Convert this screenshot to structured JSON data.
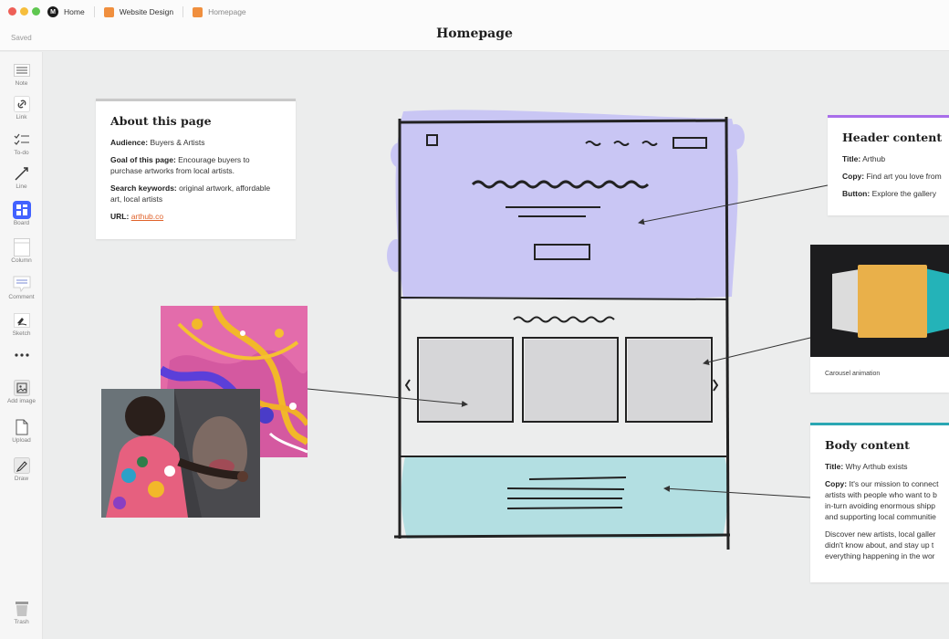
{
  "window": {
    "breadcrumbs": [
      {
        "label": "Home",
        "icon": "miro-logo-icon"
      },
      {
        "label": "Website Design",
        "icon": "board-icon"
      },
      {
        "label": "Homepage",
        "icon": "board-icon"
      }
    ],
    "saved_status": "Saved",
    "title": "Homepage"
  },
  "toolbar": {
    "items": [
      {
        "label": "Note",
        "icon": "note-icon"
      },
      {
        "label": "Link",
        "icon": "link-icon"
      },
      {
        "label": "To-do",
        "icon": "todo-icon"
      },
      {
        "label": "Line",
        "icon": "line-icon"
      },
      {
        "label": "Board",
        "icon": "board-icon"
      },
      {
        "label": "Column",
        "icon": "column-icon"
      },
      {
        "label": "Comment",
        "icon": "comment-icon"
      },
      {
        "label": "Sketch",
        "icon": "sketch-icon"
      },
      {
        "label": "",
        "icon": "more-icon"
      },
      {
        "label": "Add image",
        "icon": "add-image-icon"
      },
      {
        "label": "Upload",
        "icon": "upload-icon"
      },
      {
        "label": "Draw",
        "icon": "draw-icon"
      },
      {
        "label": "Trash",
        "icon": "trash-icon"
      }
    ]
  },
  "about": {
    "title": "About this page",
    "audience_label": "Audience:",
    "audience_value": "Buyers & Artists",
    "goal_label": "Goal of this page:",
    "goal_value": "Encourage buyers to purchase artworks from local artists.",
    "keywords_label": "Search keywords:",
    "keywords_value": "original artwork, affordable art, local artists",
    "url_label": "URL:",
    "url_value": "arthub.co"
  },
  "header_content": {
    "title": "Header content",
    "title_label": "Title:",
    "title_value": "Arthub",
    "copy_label": "Copy:",
    "copy_value": "Find art you love from",
    "button_label": "Button:",
    "button_value": "Explore the gallery"
  },
  "carousel": {
    "caption": "Carousel animation"
  },
  "body_content": {
    "title": "Body content",
    "title_label": "Title:",
    "title_value": "Why Arthub exists",
    "copy_label": "Copy:",
    "copy_lines": [
      "It's our mission to connect",
      "artists with people who want to b",
      "in-turn avoiding enormous shipp",
      "and supporting local communitie"
    ],
    "para2_lines": [
      "Discover new artists, local galler",
      "didn't know about, and stay up t",
      "everything happening in the wor"
    ]
  },
  "colors": {
    "header_accent": "#a86eea",
    "body_accent": "#2aa7b3",
    "brand_blue": "#4262ff",
    "link_orange": "#e0622a",
    "sketch_purple": "#c9c6f4",
    "sketch_teal": "#b3dfe2"
  }
}
